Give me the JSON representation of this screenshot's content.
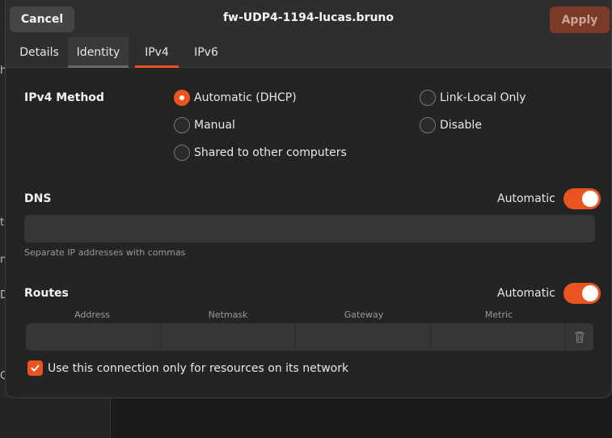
{
  "background": {
    "fragments": [
      "h",
      "ti",
      "n",
      "Dc",
      "C"
    ]
  },
  "dialog": {
    "title": "fw-UDP4-1194-lucas.bruno",
    "cancel_label": "Cancel",
    "apply_label": "Apply",
    "apply_enabled": false,
    "accent_color": "#e95420"
  },
  "tabs": [
    {
      "label": "Details",
      "state": "normal"
    },
    {
      "label": "Identity",
      "state": "hover"
    },
    {
      "label": "IPv4",
      "state": "active"
    },
    {
      "label": "IPv6",
      "state": "normal"
    }
  ],
  "ipv4": {
    "method_label": "IPv4 Method",
    "methods": [
      {
        "label": "Automatic (DHCP)",
        "checked": true
      },
      {
        "label": "Link-Local Only",
        "checked": false
      },
      {
        "label": "Manual",
        "checked": false
      },
      {
        "label": "Disable",
        "checked": false
      },
      {
        "label": "Shared to other computers",
        "checked": false
      }
    ]
  },
  "dns": {
    "label": "DNS",
    "automatic_label": "Automatic",
    "automatic_on": true,
    "value": "",
    "hint": "Separate IP addresses with commas"
  },
  "routes": {
    "label": "Routes",
    "automatic_label": "Automatic",
    "automatic_on": true,
    "columns": [
      "Address",
      "Netmask",
      "Gateway",
      "Metric"
    ],
    "rows": [
      {
        "address": "",
        "netmask": "",
        "gateway": "",
        "metric": ""
      }
    ],
    "delete_icon": "trash-icon"
  },
  "only_local": {
    "label": "Use this connection only for resources on its network",
    "checked": true
  }
}
